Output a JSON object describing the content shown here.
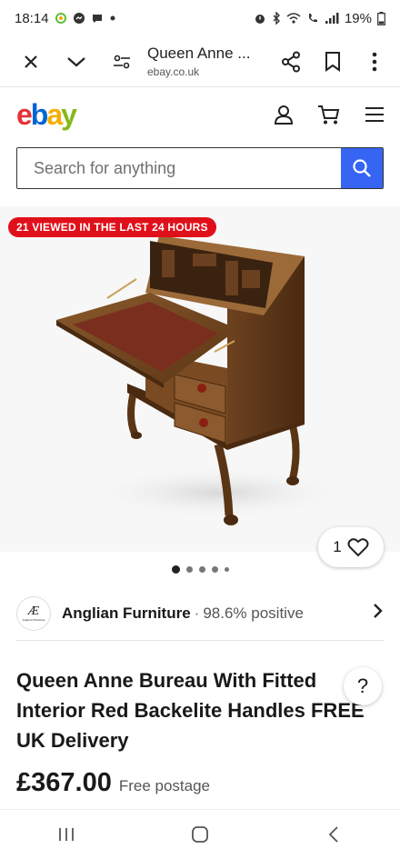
{
  "status": {
    "time": "18:14",
    "battery": "19%"
  },
  "browser": {
    "tab_title": "Queen Anne ...",
    "domain": "ebay.co.uk"
  },
  "logo": {
    "letters": [
      "e",
      "b",
      "a",
      "y"
    ],
    "colors": [
      "#e53238",
      "#0064d2",
      "#f5af02",
      "#86b817"
    ]
  },
  "search": {
    "placeholder": "Search for anything"
  },
  "listing": {
    "badge": "21 VIEWED IN THE LAST 24 HOURS",
    "watch_count": "1",
    "image_count": 5,
    "active_image": 0,
    "seller": {
      "name": "Anglian Furniture",
      "separator": "·",
      "rating": "98.6% positive",
      "logo_mono": "Æ",
      "logo_tiny": "Anglian Furniture"
    },
    "title": "Queen Anne Bureau With Fitted Interior Red Backelite Handles FREE UK Delivery",
    "price": "£367.00",
    "postage": "Free postage"
  },
  "help_label": "?",
  "colors": {
    "accent": "#3665f3",
    "badge": "#e0101b"
  }
}
